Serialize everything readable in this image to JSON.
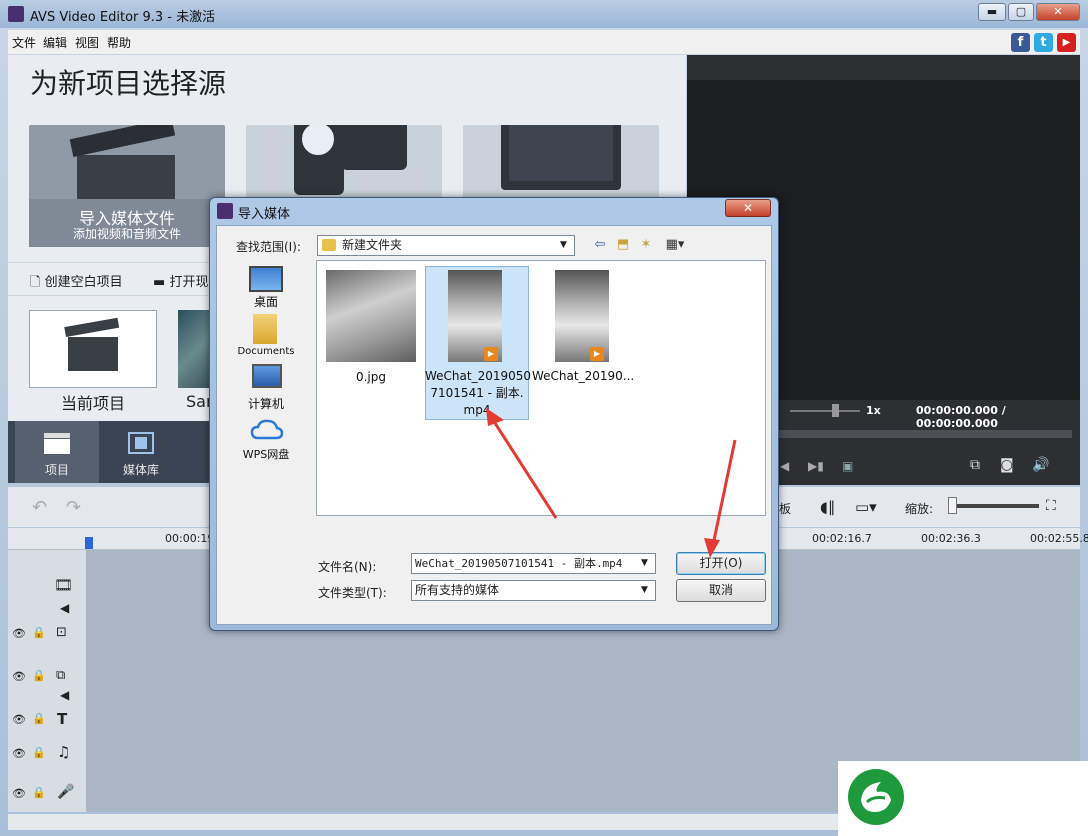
{
  "window": {
    "title": "AVS Video Editor 9.3 - 未激活",
    "min": "▬",
    "max": "▢",
    "close": "✕"
  },
  "menu": [
    "文件",
    "编辑",
    "视图",
    "帮助"
  ],
  "social": {
    "facebook": "f",
    "twitter": "t",
    "youtube": "▶"
  },
  "start": {
    "heading": "为新项目选择源",
    "import_title": "导入媒体文件",
    "import_sub": "添加视频和音频文件",
    "create_blank": "创建空白项目",
    "open_existing": "打开现",
    "current_project": "当前项目",
    "sample_label": "Sar"
  },
  "nav": [
    {
      "label": "项目",
      "icon": "clapperboard-icon"
    },
    {
      "label": "媒体库",
      "icon": "film-icon"
    }
  ],
  "preview": {
    "speed": "1x",
    "time": "00:00:00.000 / 00:00:00.000"
  },
  "toolbar": {
    "panel_partial": "板",
    "zoom_label": "缩放:"
  },
  "ruler": [
    "00:00:19",
    "00:02:16.7",
    "00:02:36.3",
    "00:02:55.8"
  ],
  "dialog": {
    "title": "导入媒体",
    "close": "✕",
    "look_in_label": "查找范围(I):",
    "look_in_value": "新建文件夹",
    "places": [
      "桌面",
      "Documents",
      "计算机",
      "WPS网盘"
    ],
    "files": [
      {
        "name": "0.jpg"
      },
      {
        "name_lines": [
          "WeChat_2019050",
          "7101541 - 副本.",
          "mp4"
        ]
      },
      {
        "name": "WeChat_20190..."
      }
    ],
    "filename_label": "文件名(N):",
    "filename_value": "WeChat_20190507101541 - 副本.mp4",
    "filetype_label": "文件类型(T):",
    "filetype_value": "所有支持的媒体",
    "open_button": "打开(O)",
    "cancel_button": "取消"
  },
  "colors": {
    "annotation_arrow": "#e23b33",
    "logo_green": "#1e9a3c"
  }
}
